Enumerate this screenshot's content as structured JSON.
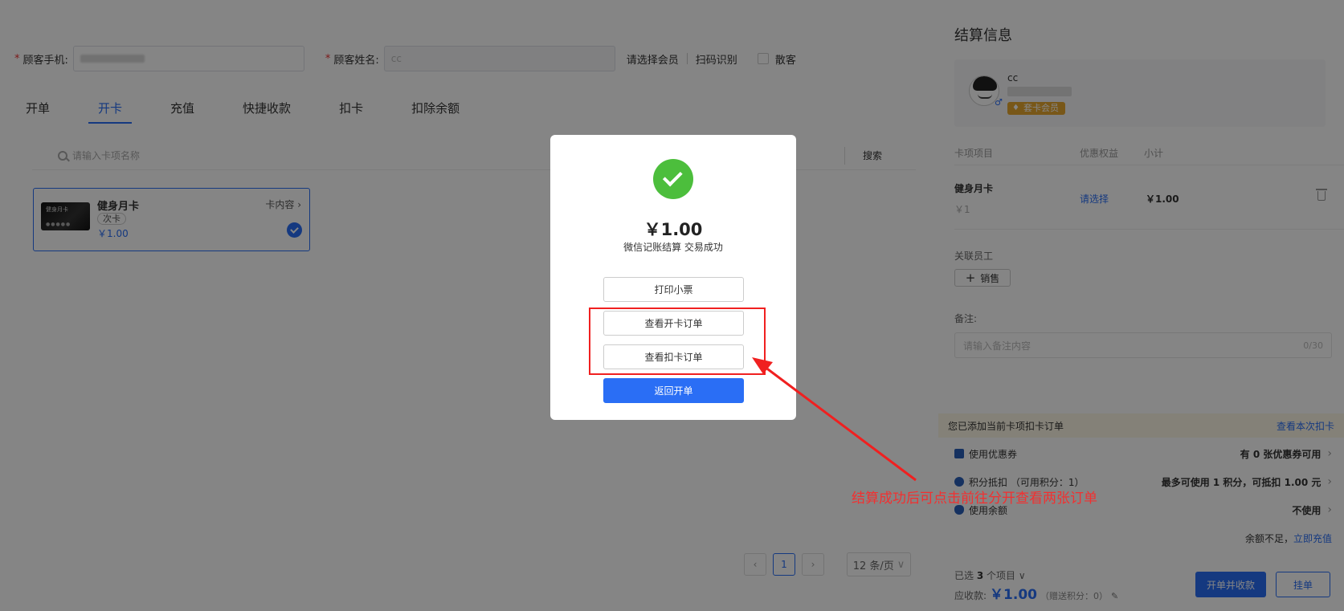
{
  "form": {
    "phone_label": "顾客手机:",
    "name_label": "顾客姓名:",
    "name_value": "cc",
    "select_member": "请选择会员",
    "scan": "扫码识别",
    "walk_in": "散客"
  },
  "tabs": [
    "开单",
    "开卡",
    "充值",
    "快捷收款",
    "扣卡",
    "扣除余额"
  ],
  "search": {
    "placeholder": "请输入卡项名称",
    "button": "搜索"
  },
  "card": {
    "image_text": "健身月卡",
    "image_dots": "●●●●●",
    "name": "健身月卡",
    "tag": "次卡",
    "price": "￥1.00",
    "link": "卡内容"
  },
  "pager": {
    "prev": "‹",
    "page": "1",
    "next": "›",
    "size": "12 条/页"
  },
  "side": {
    "title": "结算信息",
    "member_name": "cc",
    "member_badge": "套卡会员",
    "col_item": "卡项项目",
    "col_benefit": "优惠权益",
    "col_subtotal": "小计",
    "item_name": "健身月卡",
    "item_sub": "￥1",
    "item_pick": "请选择",
    "item_price": "￥1.00",
    "staff_label": "关联员工",
    "staff_btn": "销售",
    "remark_label": "备注:",
    "remark_placeholder": "请输入备注内容",
    "remark_count": "0/30",
    "notice": "您已添加当前卡项扣卡订单",
    "notice_link": "查看本次扣卡",
    "coupon_label": "使用优惠券",
    "coupon_value": "有 0 张优惠券可用",
    "points_label": "积分抵扣 （可用积分：1）",
    "points_value": "最多可使用 1 积分，可抵扣 1.00 元",
    "balance_label": "使用余额",
    "balance_value": "不使用",
    "topup_text": "余额不足，",
    "topup_link": "立即充值",
    "selected_prefix": "已选",
    "selected_count": "3",
    "selected_suffix": "个项目",
    "due_label": "应收款:",
    "due_amount": "￥1.00",
    "due_points": "（赠送积分：0）",
    "btn_checkout": "开单并收款",
    "btn_hold": "挂单"
  },
  "modal": {
    "amount": "￥1.00",
    "message": "微信记账结算 交易成功",
    "btn_print": "打印小票",
    "btn_open_order": "查看开卡订单",
    "btn_deduct_order": "查看扣卡订单",
    "btn_return": "返回开单"
  },
  "annotation": {
    "text": "结算成功后可点击前往分开查看两张订单",
    "color": "#f02020"
  },
  "colors": {
    "accent": "#2a6ef5",
    "success": "#4cbe3c",
    "badge": "#e7a72f"
  }
}
